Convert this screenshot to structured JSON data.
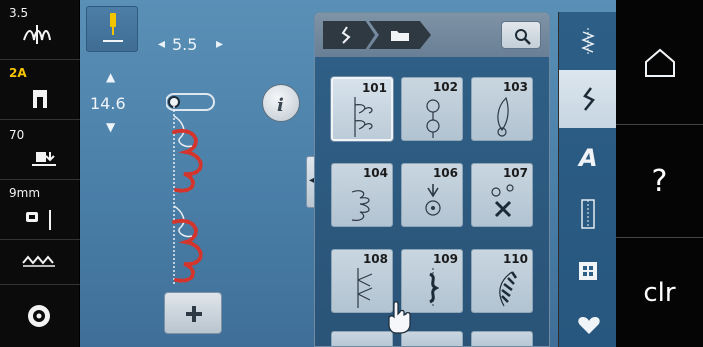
{
  "left_bar": {
    "tension": "3.5",
    "presser_foot": "2A",
    "foot_pressure": "70",
    "needle_size": "9mm"
  },
  "stitch_settings": {
    "width": "5.5",
    "length": "14.6"
  },
  "stitches": [
    {
      "number": "101",
      "selected": true
    },
    {
      "number": "102",
      "selected": false
    },
    {
      "number": "103",
      "selected": false
    },
    {
      "number": "104",
      "selected": false
    },
    {
      "number": "106",
      "selected": false
    },
    {
      "number": "107",
      "selected": false
    },
    {
      "number": "108",
      "selected": false
    },
    {
      "number": "109",
      "selected": false
    },
    {
      "number": "110",
      "selected": false
    }
  ],
  "right_bar": {
    "help": "?",
    "clear": "clr"
  },
  "colors": {
    "main_bg": "#4a7fa8",
    "stitch_red": "#d3352c",
    "active_gold": "#f4c400",
    "dark": "#0b0b0b"
  },
  "icons": [
    "thread-tension-icon",
    "presser-foot-icon",
    "foot-pressure-icon",
    "needle-position-icon",
    "stitch-pattern-icon",
    "bobbin-icon",
    "needle-icon",
    "home-icon",
    "info-icon",
    "plus-icon",
    "search-icon",
    "decorative-stitch-icon",
    "folder-icon",
    "cursor-hand-icon",
    "heart-icon",
    "alphabet-icon",
    "buttonhole-icon",
    "quilt-icon",
    "practical-stitch-icon"
  ]
}
